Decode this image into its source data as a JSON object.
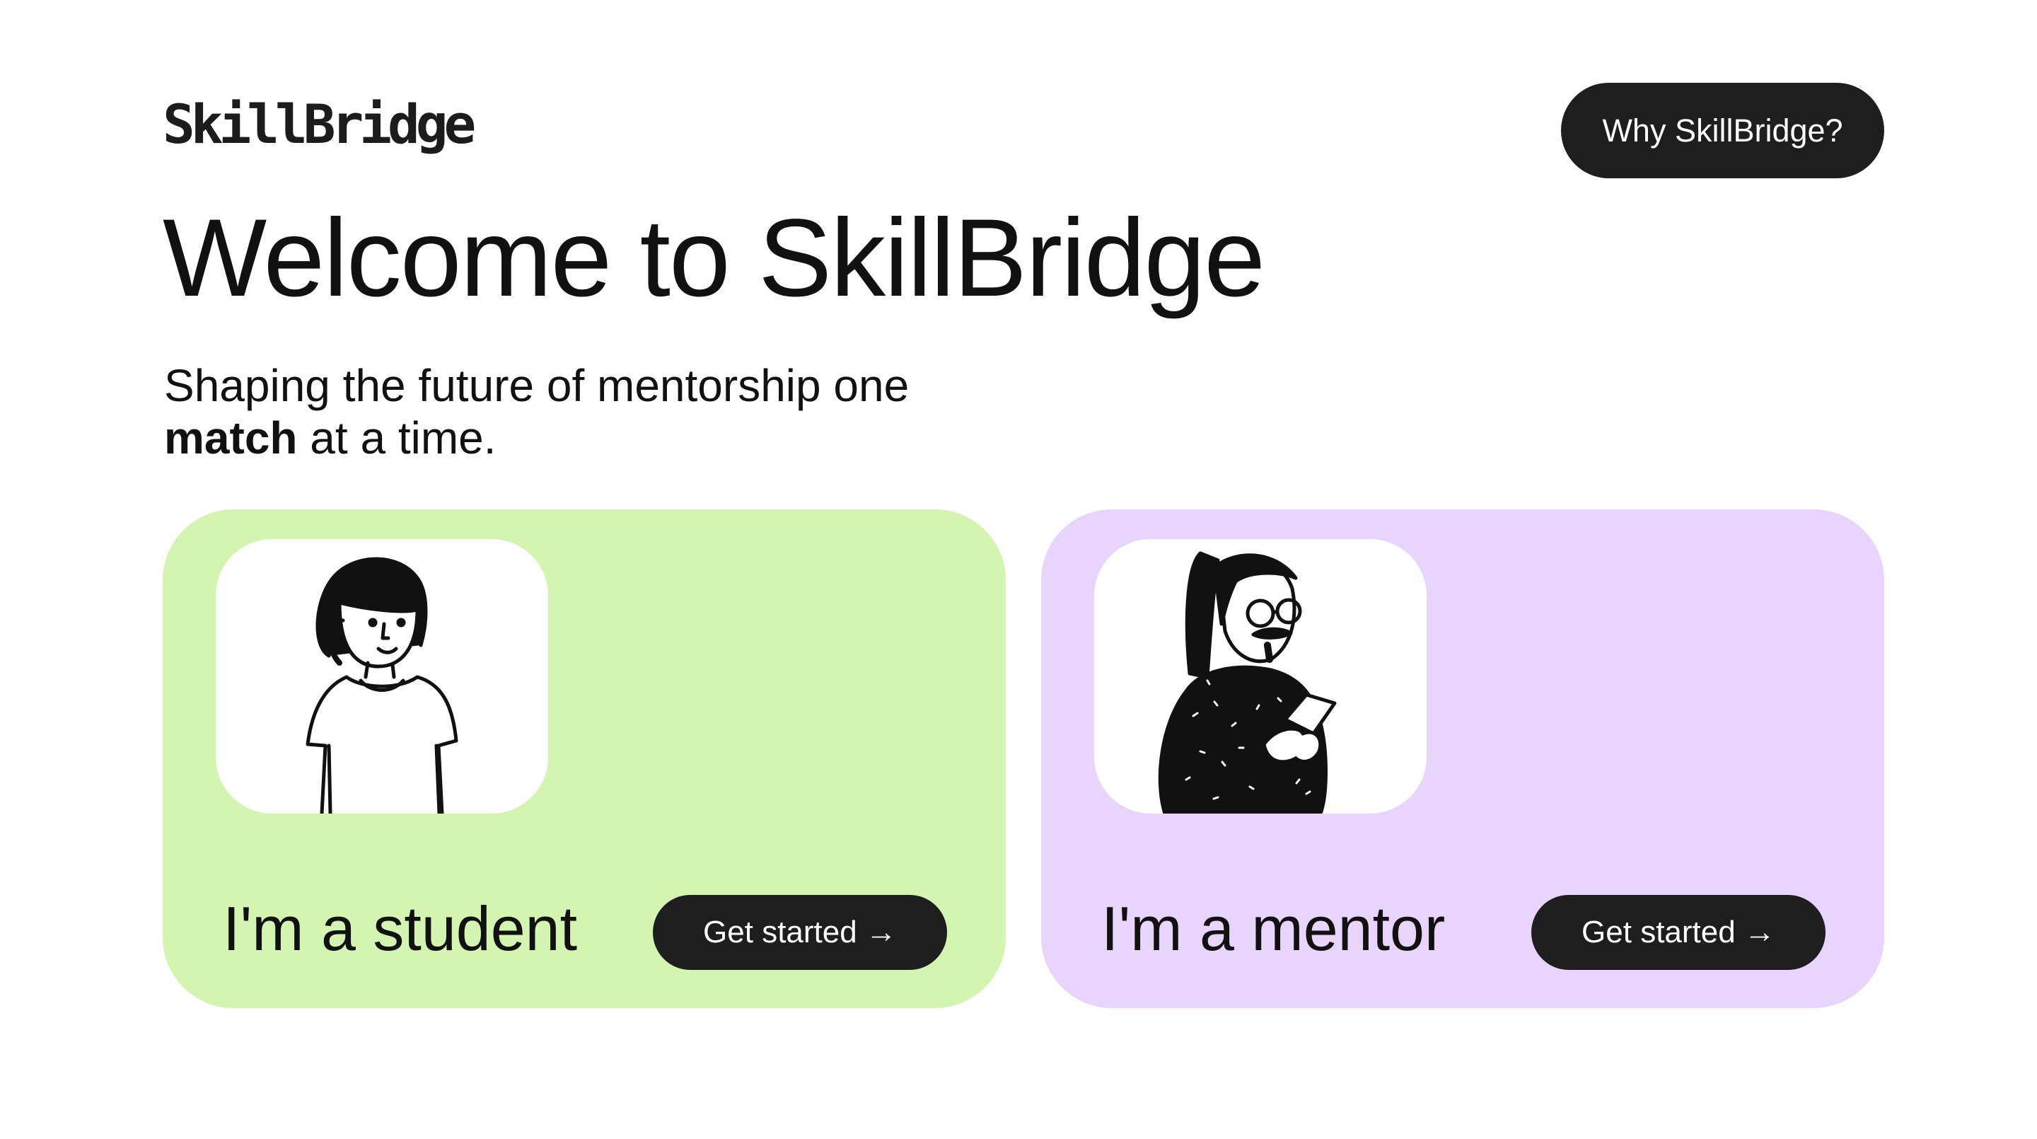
{
  "header": {
    "logo": "SkillBridge",
    "why_button": "Why SkillBridge?"
  },
  "hero": {
    "title": "Welcome to SkillBridge",
    "subtitle_line1": "Shaping the future of mentorship one",
    "subtitle_bold": "match",
    "subtitle_line2_rest": " at a time."
  },
  "cards": {
    "student": {
      "title": "I'm a student",
      "cta": "Get started →",
      "color": "#d4f5b2"
    },
    "mentor": {
      "title": "I'm a mentor",
      "cta": "Get started →",
      "color": "#e8d4fc"
    }
  },
  "colors": {
    "button_bg": "#1e1e1e",
    "button_text": "#ffffff"
  }
}
